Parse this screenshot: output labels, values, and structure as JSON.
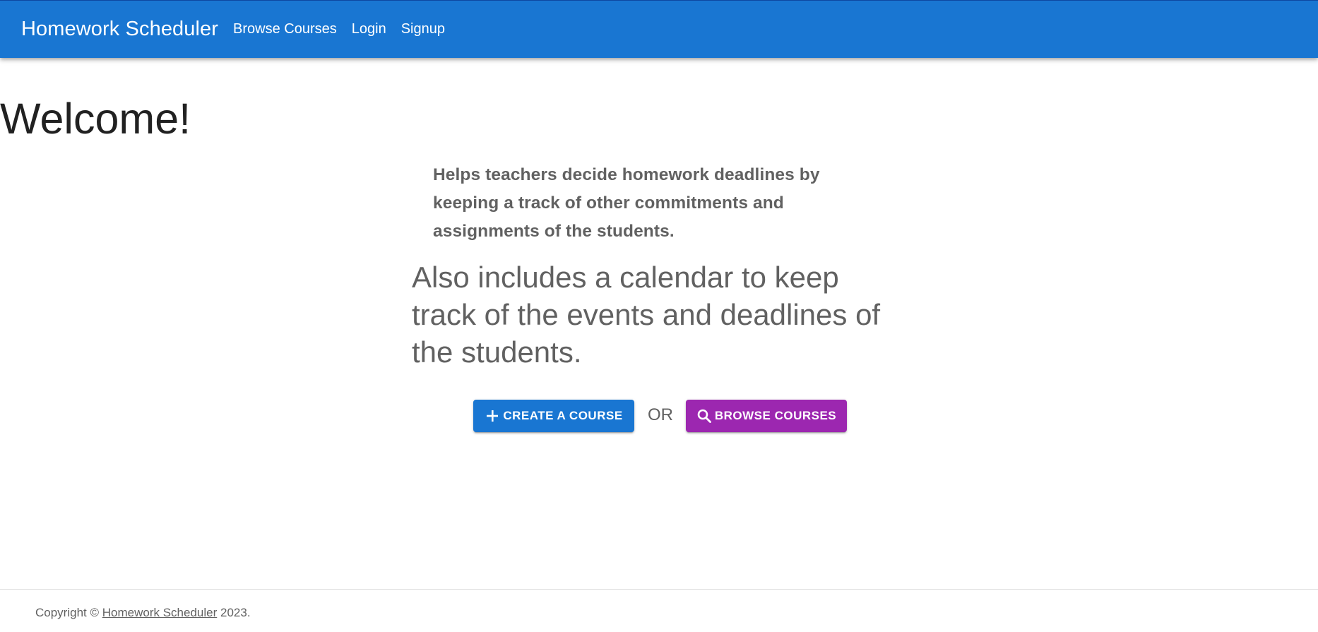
{
  "appbar": {
    "brand": "Homework Scheduler",
    "nav": [
      {
        "label": "Browse Courses"
      },
      {
        "label": "Login"
      },
      {
        "label": "Signup"
      }
    ],
    "color": "#1976d2"
  },
  "hero": {
    "title": "Welcome!",
    "subtitle": "Helps teachers decide homework deadlines by keeping a track of other commitments and assignments of the students.",
    "tagline": "Also includes a calendar to keep track of the events and deadlines of the students."
  },
  "actions": {
    "create_label": "Create a course",
    "create_icon": "plus-icon",
    "create_color": "#1976d2",
    "or_label": "OR",
    "browse_label": "Browse courses",
    "browse_icon": "search-icon",
    "browse_color": "#9c27b0"
  },
  "footer": {
    "copyright_prefix": "Copyright ©",
    "copyright_link": "Homework Scheduler",
    "copyright_suffix": "2023."
  }
}
